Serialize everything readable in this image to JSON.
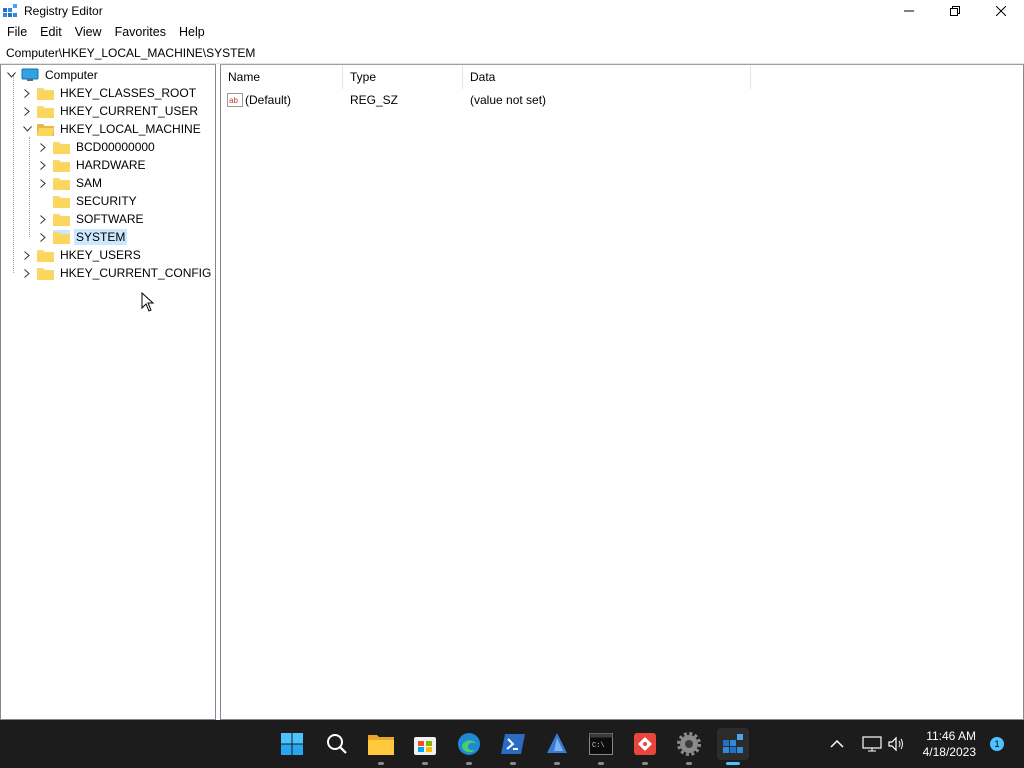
{
  "window": {
    "title": "Registry Editor"
  },
  "menu": [
    "File",
    "Edit",
    "View",
    "Favorites",
    "Help"
  ],
  "address": "Computer\\HKEY_LOCAL_MACHINE\\SYSTEM",
  "tree": {
    "root": "Computer",
    "hives": [
      "HKEY_CLASSES_ROOT",
      "HKEY_CURRENT_USER",
      "HKEY_LOCAL_MACHINE"
    ],
    "hklm_children": [
      "BCD00000000",
      "HARDWARE",
      "SAM",
      "SECURITY",
      "SOFTWARE",
      "SYSTEM"
    ],
    "hives_after": [
      "HKEY_USERS",
      "HKEY_CURRENT_CONFIG"
    ],
    "selected": "SYSTEM"
  },
  "list": {
    "columns": [
      "Name",
      "Type",
      "Data"
    ],
    "rows": [
      {
        "name": "(Default)",
        "type": "REG_SZ",
        "data": "(value not set)"
      }
    ]
  },
  "taskbar": {
    "apps": [
      "start-icon",
      "search-icon",
      "file-explorer-icon",
      "store-icon",
      "edge-icon",
      "powershell-icon",
      "app-icon",
      "terminal-icon",
      "git-icon",
      "settings-icon",
      "registry-editor-icon"
    ],
    "time": "11:46 AM",
    "date": "4/18/2023",
    "notification_count": "1"
  },
  "colors": {
    "selection": "#cce8ff",
    "taskbar": "#1c1c1c",
    "accent": "#4cc2ff",
    "folder": "#f8d775"
  }
}
